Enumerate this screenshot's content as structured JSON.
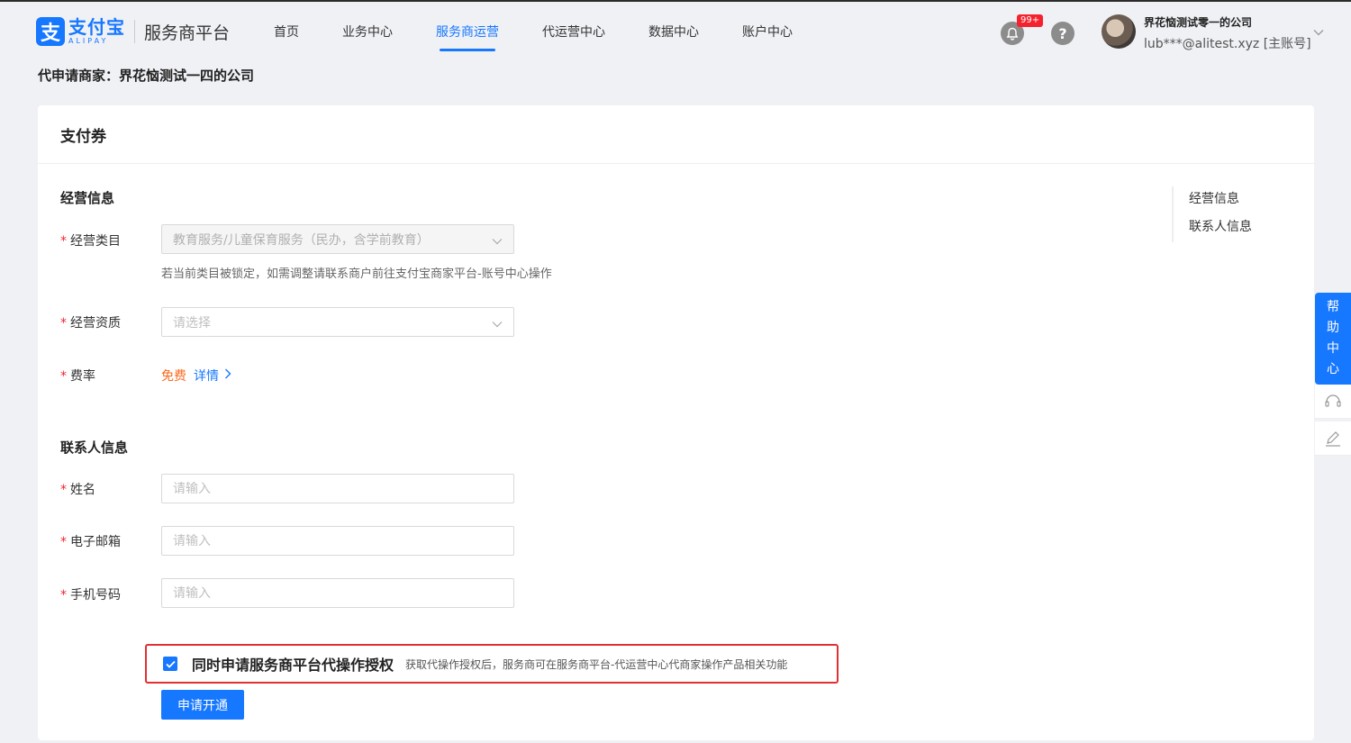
{
  "brand": {
    "logo_glyph": "支",
    "logo_cn": "支付宝",
    "logo_en": "ALIPAY",
    "platform": "服务商平台",
    "color": "#1677ff"
  },
  "nav": [
    {
      "label": "首页",
      "active": false
    },
    {
      "label": "业务中心",
      "active": false
    },
    {
      "label": "服务商运营",
      "active": true
    },
    {
      "label": "代运营中心",
      "active": false
    },
    {
      "label": "数据中心",
      "active": false
    },
    {
      "label": "账户中心",
      "active": false
    }
  ],
  "header": {
    "notification_badge": "99+",
    "help_glyph": "?",
    "user_name": "界花恼测试零一的公司",
    "user_email": "lub***@alitest.xyz [主账号]"
  },
  "merchant_title": "代申请商家：界花恼测试一四的公司",
  "card": {
    "title": "支付券",
    "business_section": {
      "title": "经营信息",
      "category_label": "经营类目",
      "category_value": "教育服务/儿童保育服务（民办，含学前教育）",
      "category_hint": "若当前类目被锁定，如需调整请联系商户前往支付宝商家平台-账号中心操作",
      "qualification_label": "经营资质",
      "qualification_placeholder": "请选择",
      "fee_label": "费率",
      "fee_value": "免费",
      "fee_detail": "详情"
    },
    "contact_section": {
      "title": "联系人信息",
      "name_label": "姓名",
      "name_placeholder": "请输入",
      "email_label": "电子邮箱",
      "email_placeholder": "请输入",
      "phone_label": "手机号码",
      "phone_placeholder": "请输入"
    },
    "auth": {
      "checked": true,
      "label": "同时申请服务商平台代操作授权",
      "description": "获取代操作授权后，服务商可在服务商平台-代运营中心代商家操作产品相关功能"
    },
    "submit_label": "申请开通",
    "anchors": [
      "经营信息",
      "联系人信息"
    ]
  },
  "side_help": {
    "chars": [
      "帮",
      "助",
      "中",
      "心"
    ]
  },
  "required_mark": "*"
}
